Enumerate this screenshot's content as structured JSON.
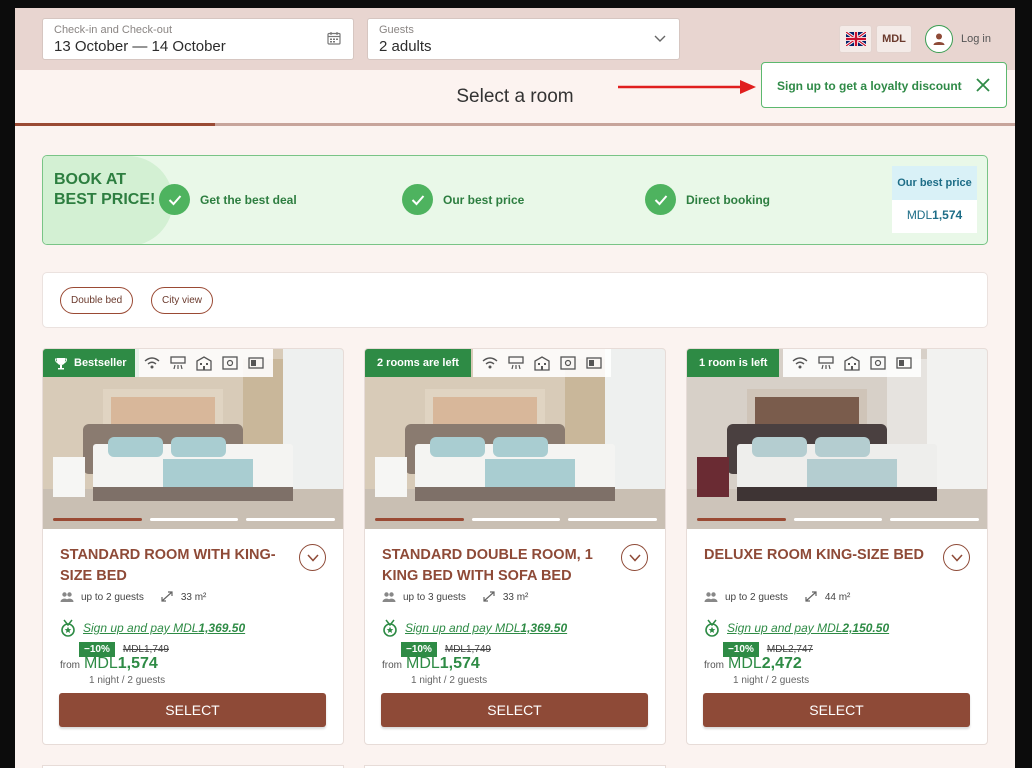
{
  "header": {
    "checkin_label": "Check-in and Check-out",
    "checkin_value": "13 October — 14 October",
    "guests_label": "Guests",
    "guests_value": "2 adults",
    "currency": "MDL",
    "login": "Log in"
  },
  "page": {
    "title": "Select a room",
    "progress_fraction": 0.2
  },
  "tooltip": {
    "text": "Sign up to get a loyalty discount"
  },
  "banner": {
    "headline": "BOOK AT BEST PRICE!",
    "features": [
      "Get the best deal",
      "Our best price",
      "Direct booking"
    ],
    "best_price_label": "Our best price",
    "best_price_currency": "MDL",
    "best_price_value": "1,574"
  },
  "filters": [
    "Double bed",
    "City view"
  ],
  "rooms": [
    {
      "badge": "Bestseller",
      "name": "STANDARD ROOM WITH KING-SIZE BED",
      "guests": "up to 2 guests",
      "area": "33 m²",
      "promo_prefix": "Sign up and pay MDL",
      "promo_value": "1,369.50",
      "discount": "−10%",
      "old_price": "MDL1,749",
      "from": "from",
      "currency": "MDL",
      "price": "1,574",
      "nights": "1 night / 2 guests",
      "button": "SELECT"
    },
    {
      "badge": "2 rooms are left",
      "name": "STANDARD DOUBLE ROOM, 1 KING BED WITH SOFA BED",
      "guests": "up to 3 guests",
      "area": "33 m²",
      "promo_prefix": "Sign up and pay MDL",
      "promo_value": "1,369.50",
      "discount": "−10%",
      "old_price": "MDL1,749",
      "from": "from",
      "currency": "MDL",
      "price": "1,574",
      "nights": "1 night / 2 guests",
      "button": "SELECT"
    },
    {
      "badge": "1 room is left",
      "name": "DELUXE ROOM KING-SIZE BED",
      "guests": "up to 2 guests",
      "area": "44 m²",
      "promo_prefix": "Sign up and pay MDL",
      "promo_value": "2,150.50",
      "discount": "−10%",
      "old_price": "MDL2,747",
      "from": "from",
      "currency": "MDL",
      "price": "2,472",
      "nights": "1 night / 2 guests",
      "button": "SELECT"
    }
  ],
  "colors": {
    "brand": "#8e4a37",
    "accent_green": "#2e8b45",
    "header_bg": "#e8d5d0"
  }
}
